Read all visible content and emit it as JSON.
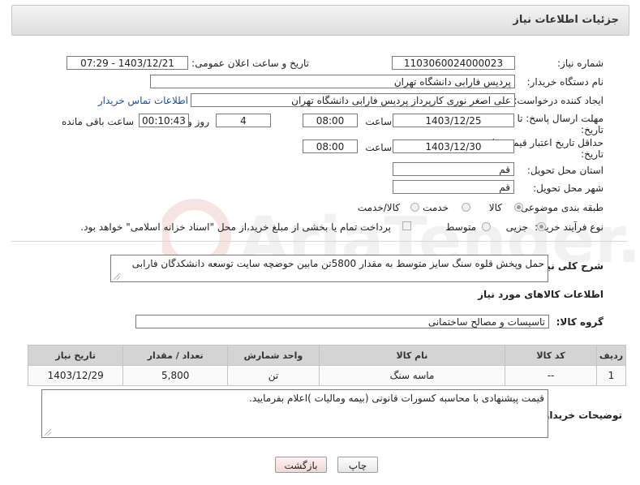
{
  "header": {
    "title": "جزئیات اطلاعات نیاز"
  },
  "fields": {
    "need_number_label": "شماره نیاز:",
    "need_number": "1103060024000023",
    "announce_label": "تاریخ و ساعت اعلان عمومی:",
    "announce_value": "1403/12/21 - 07:29",
    "buyer_org_label": "نام دستگاه خریدار:",
    "buyer_org": "پردیس فارابی دانشگاه تهران",
    "requester_label": "ایجاد کننده درخواست:",
    "requester": "علی اصغر نوری کارپرداز پردیس فارابی دانشگاه تهران",
    "contact_link": "اطلاعات تماس خریدار",
    "deadline_label_1": "مهلت ارسال پاسخ: تا",
    "deadline_label_2": "تاریخ:",
    "deadline_date": "1403/12/25",
    "time_label": "ساعت",
    "deadline_time": "08:00",
    "days_value": "4",
    "days_label": "روز و",
    "remaining_time": "00:10:43",
    "remaining_label": "ساعت باقی مانده",
    "validity_label_1": "حداقل تاریخ اعتبار قیمت: تا",
    "validity_label_2": "تاریخ:",
    "validity_date": "1403/12/30",
    "validity_time": "08:00",
    "province_label": "استان محل تحویل:",
    "province": "قم",
    "city_label": "شهر محل تحویل:",
    "city": "قم",
    "category_label": "طبقه بندی موضوعی:",
    "category_options": [
      "کالا",
      "خدمت",
      "کالا/خدمت"
    ],
    "purchase_type_label": "نوع فرآیند خرید :",
    "purchase_options": [
      "جزیی",
      "متوسط"
    ],
    "payment_note": "پرداخت تمام یا بخشی از مبلغ خرید،از محل \"اسناد خزانه اسلامی\" خواهد بود."
  },
  "description": {
    "label": "شرح کلی نیاز:",
    "text": "حمل وپخش قلوه سنگ سایز متوسط به مقدار 5800تن مابین حوضچه سایت توسعه دانشکدگان فارابی"
  },
  "goods_section": {
    "title": "اطلاعات کالاهای مورد نیاز",
    "group_label": "گروه کالا:",
    "group_value": "تاسیسات و مصالح ساختمانی"
  },
  "table": {
    "headers": [
      "ردیف",
      "کد کالا",
      "نام کالا",
      "واحد شمارش",
      "تعداد / مقدار",
      "تاریخ نیاز"
    ],
    "rows": [
      [
        "1",
        "--",
        "ماسه سنگ",
        "تن",
        "5,800",
        "1403/12/29"
      ]
    ]
  },
  "buyer_notes": {
    "label": "توضیحات خریدار:",
    "text": "قیمت پیشنهادی با محاسبه کسورات قانونی (بیمه ومالیات )اعلام بفرمایید."
  },
  "buttons": {
    "print": "چاپ",
    "back": "بازگشت"
  },
  "watermark": "AriaTender.net",
  "colors": {
    "link": "#1a4fa0",
    "header_bg": "#dddddd",
    "table_header": "#d4d4d4"
  }
}
